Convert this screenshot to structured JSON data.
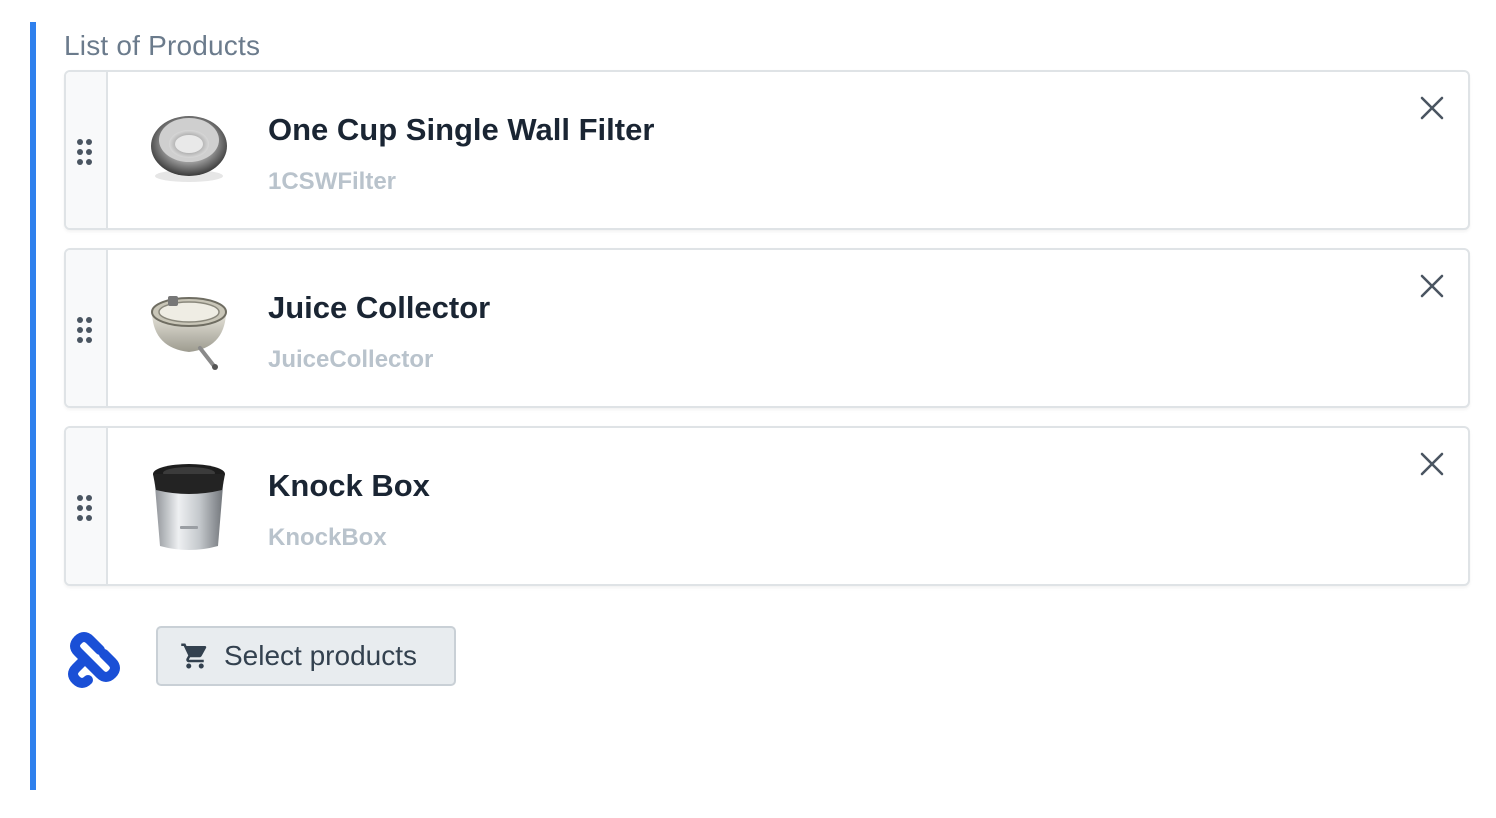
{
  "field": {
    "label": "List of Products",
    "accent_color": "#2f80ed"
  },
  "products": [
    {
      "name": "One Cup Single Wall Filter",
      "sku": "1CSWFilter",
      "image": "filter-basket-image"
    },
    {
      "name": "Juice Collector",
      "sku": "JuiceCollector",
      "image": "juice-collector-image"
    },
    {
      "name": "Knock Box",
      "sku": "KnockBox",
      "image": "knock-box-image"
    }
  ],
  "icons": {
    "drag": "drag-handle-icon",
    "remove": "close-icon",
    "cart": "cart-icon",
    "logo": "plugin-logo-icon"
  },
  "footer": {
    "select_label": "Select products"
  }
}
